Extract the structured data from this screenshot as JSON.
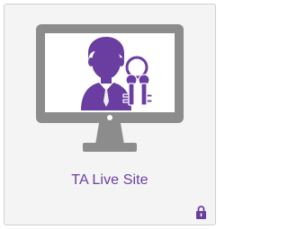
{
  "tile": {
    "label": "TA Live Site",
    "icon": "monitor-user-key-icon",
    "badge_icon": "lock-icon"
  },
  "colors": {
    "accent": "#6a3ea1",
    "monitor_gray": "#8c8c8c",
    "tile_background": "#f4f4f4"
  }
}
